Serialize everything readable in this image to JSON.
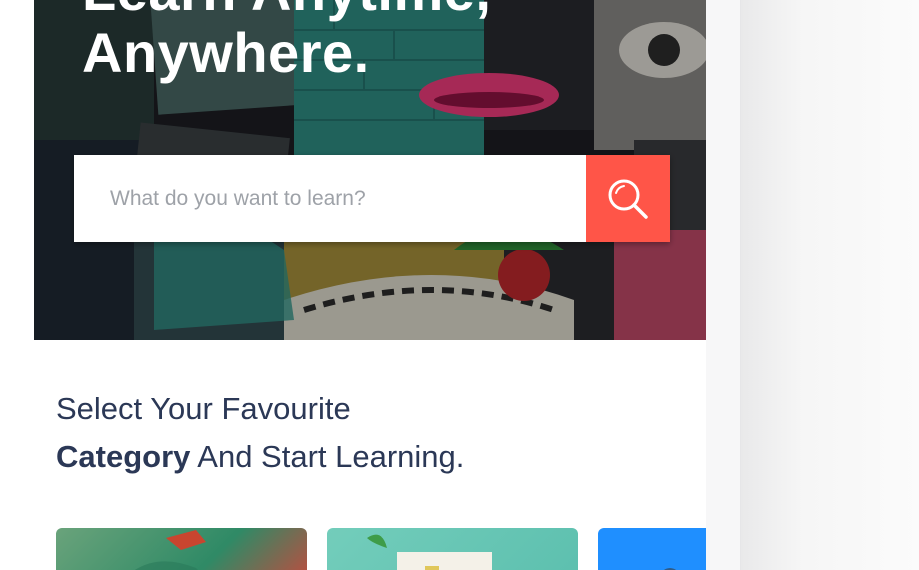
{
  "hero": {
    "title_line1": "Learn Anytime,",
    "title_line2": "Anywhere."
  },
  "search": {
    "placeholder": "What do you want to learn?",
    "button_icon": "search-icon"
  },
  "section": {
    "line1": "Select Your Favourite",
    "line2_bold": "Category",
    "line2_rest": " And Start Learning."
  },
  "colors": {
    "accent": "#ff5548",
    "heading": "#2b3856"
  }
}
